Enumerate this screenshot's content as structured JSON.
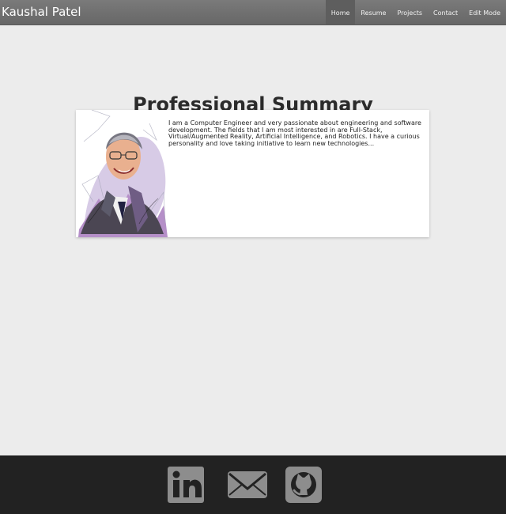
{
  "navbar": {
    "brand": "Kaushal Patel",
    "items": [
      {
        "label": "Home",
        "active": true
      },
      {
        "label": "Resume",
        "active": false
      },
      {
        "label": "Projects",
        "active": false
      },
      {
        "label": "Contact",
        "active": false
      },
      {
        "label": "Edit Mode",
        "active": false
      }
    ]
  },
  "main": {
    "title": "Professional Summary",
    "summary": "I am a Computer Engineer and very passionate about engineering and software development. The fields that I am most interested in are Full-Stack, Virtual/Augmented Reality, Artificial Intelligence, and Robotics. I have a curious personality and love taking initiative to learn new technologies..."
  },
  "footer": {
    "icons": [
      "linkedin-icon",
      "mail-icon",
      "github-icon"
    ]
  },
  "colors": {
    "navbar": "#6f6f6f",
    "active_nav": "#5e5e5e",
    "page_background": "#ececec",
    "footer": "#222222",
    "social_icon": "#8d8d8d"
  }
}
